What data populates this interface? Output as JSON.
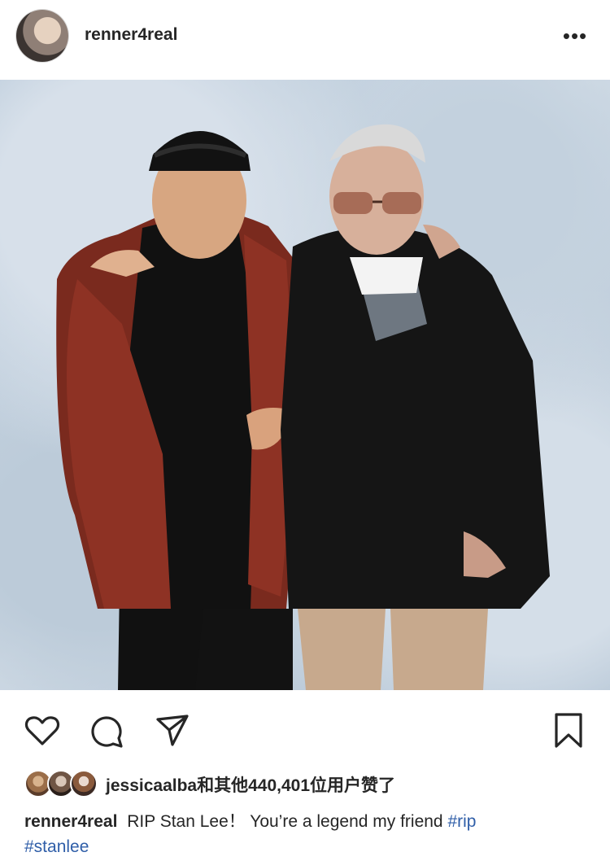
{
  "post": {
    "username": "renner4real",
    "more_icon": "•••"
  },
  "likes": {
    "text": "jessicaalba和其他440,401位用户赞了"
  },
  "caption": {
    "username": "renner4real",
    "text": "RIP Stan Lee！ You’re a legend my friend",
    "hashtags": [
      "#rip",
      "#stanlee"
    ]
  },
  "icons": {
    "more": "more-options-icon",
    "like": "heart-icon",
    "comment": "comment-icon",
    "share": "send-icon",
    "save": "bookmark-icon"
  },
  "colors": {
    "hashtag": "#2f5ea8",
    "text": "#262626"
  }
}
